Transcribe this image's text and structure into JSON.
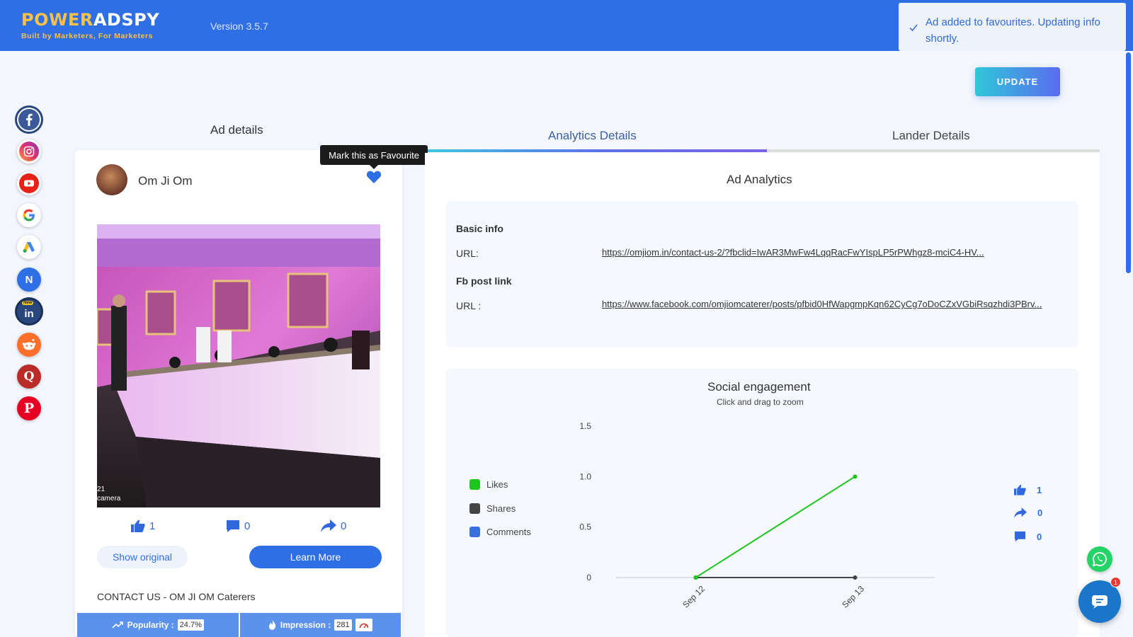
{
  "header": {
    "logo_main_1": "POWER",
    "logo_main_2": "ADSPY",
    "logo_tagline": "Built by Marketers, For Marketers",
    "version": "Version 3.5.7",
    "toast": "Ad added to favourites. Updating info shortly.",
    "brand_color": "#2f6fe6"
  },
  "sidebar": {
    "items": [
      {
        "name": "facebook-icon",
        "active": true
      },
      {
        "name": "instagram-icon"
      },
      {
        "name": "youtube-icon"
      },
      {
        "name": "google-icon"
      },
      {
        "name": "google-ads-icon"
      },
      {
        "name": "native-icon",
        "label": "N"
      },
      {
        "name": "linkedin-icon",
        "label": "in",
        "badge": "New"
      },
      {
        "name": "reddit-icon"
      },
      {
        "name": "quora-icon",
        "label": "Q"
      },
      {
        "name": "pinterest-icon",
        "label": "P"
      }
    ]
  },
  "update_button": "UPDATE",
  "tabs": {
    "ad_details": "Ad details",
    "analytics": "Analytics Details",
    "lander": "Lander Details"
  },
  "ad": {
    "advertiser": "Om Ji Om",
    "tooltip": "Mark this as Favourite",
    "image_caption_1": "21",
    "image_caption_2": "camera",
    "likes": "1",
    "comments": "0",
    "shares": "0",
    "show_original": "Show original",
    "learn_more": "Learn More",
    "title": "CONTACT US - OM JI OM Caterers",
    "popularity_label": "Popularity :",
    "popularity_value": "24.7%",
    "impression_label": "Impression :",
    "impression_value": "281"
  },
  "analytics": {
    "title": "Ad Analytics",
    "basic_info": "Basic info",
    "url_label": "URL:",
    "url": "https://omjiom.in/contact-us-2/?fbclid=IwAR3MwFw4LqqRacFwYIspLP5rPWhgz8-mciC4-HV...",
    "fb_post_link": "Fb post link",
    "fb_url_label": "URL :",
    "fb_url": "https://www.facebook.com/omjiomcaterer/posts/pfbid0HfWapgmpKqn62CyCg7oDoCZxVGbiRsqzhdi3PBrv...",
    "engagement_title": "Social engagement",
    "engagement_sub": "Click and drag to zoom",
    "side_likes": "1",
    "side_shares": "0",
    "side_comments": "0"
  },
  "chart_data": {
    "type": "line",
    "title": "Social engagement",
    "subtitle": "Click and drag to zoom",
    "categories": [
      "Sep 12",
      "Sep 13"
    ],
    "series": [
      {
        "name": "Likes",
        "color": "#1ec51e",
        "values": [
          0,
          1
        ]
      },
      {
        "name": "Shares",
        "color": "#444444",
        "values": [
          0,
          0
        ]
      },
      {
        "name": "Comments",
        "color": "#3a6fe0",
        "values": [
          0,
          0
        ]
      }
    ],
    "yticks": [
      "0",
      "0.5",
      "1.0",
      "1.5"
    ],
    "ylim": [
      0,
      1.5
    ],
    "legend_position": "left",
    "grid": false
  }
}
